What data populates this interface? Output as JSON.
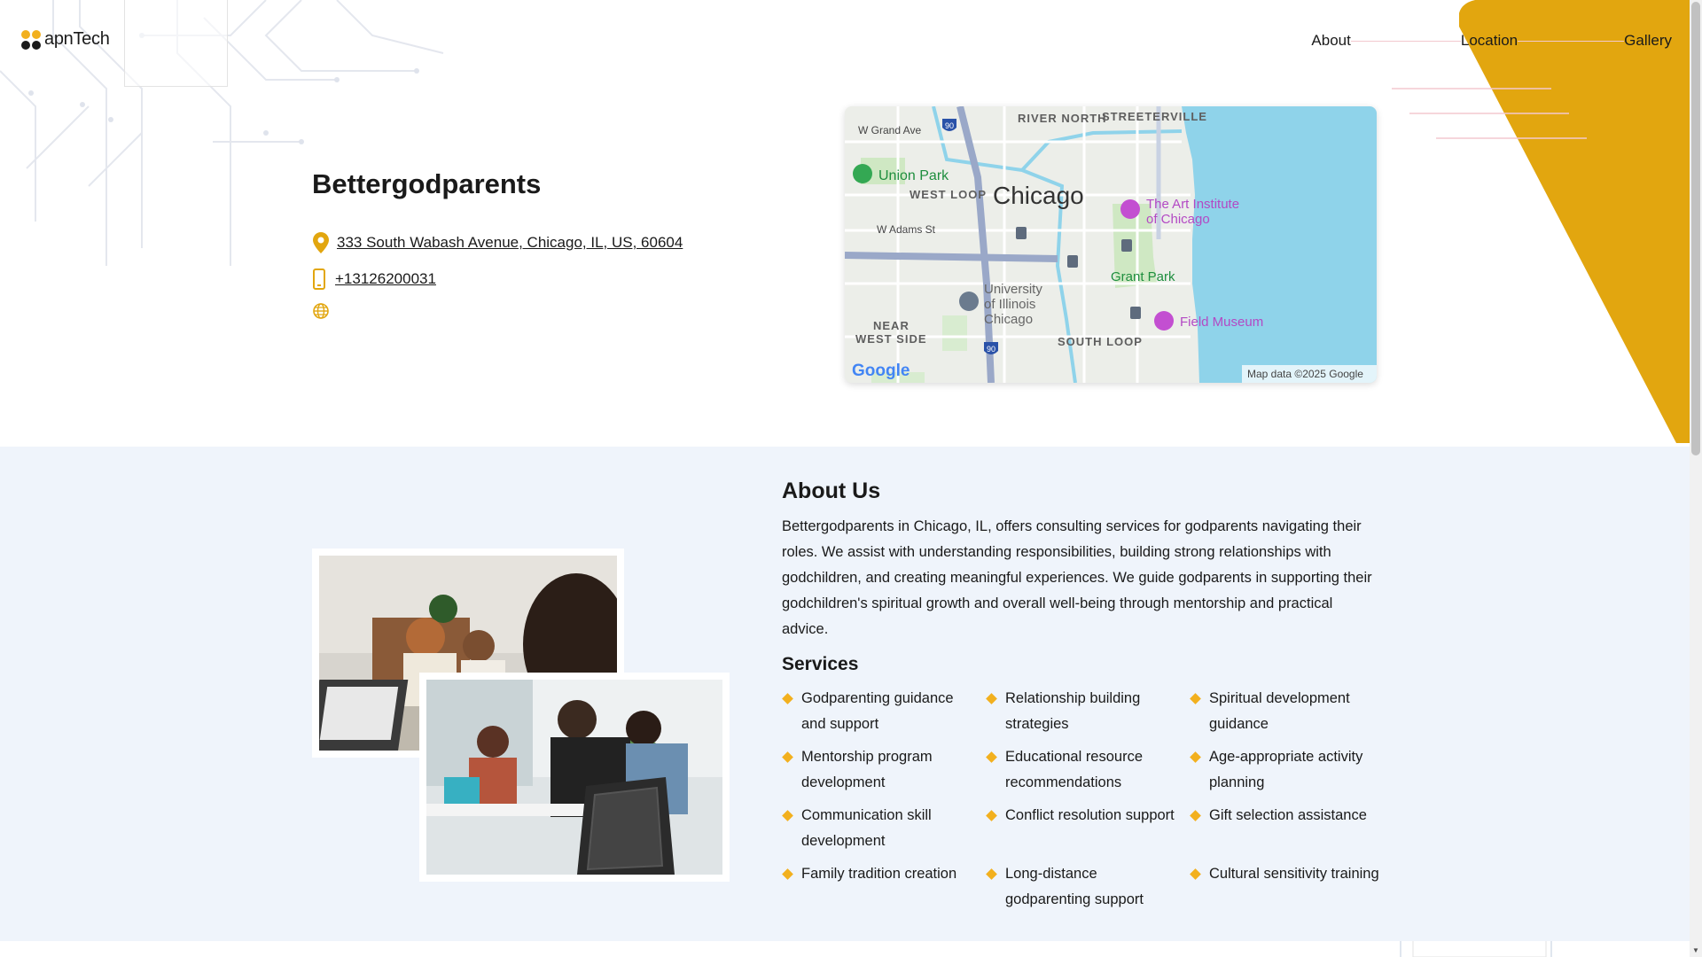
{
  "header": {
    "logo_text": "apnTech",
    "nav": [
      {
        "label": "About"
      },
      {
        "label": "Location"
      },
      {
        "label": "Gallery"
      }
    ]
  },
  "business": {
    "name": "Bettergodparents",
    "address": "333 South Wabash Avenue, Chicago, IL, US, 60604",
    "phone": "+13126200031"
  },
  "map": {
    "labels": {
      "river_north": "RIVER NORTH",
      "streeterville": "STREETERVILLE",
      "w_grand_ave": "W Grand Ave",
      "union_park": "Union Park",
      "west_loop": "WEST LOOP",
      "city": "Chicago",
      "art_institute_1": "The Art Institute",
      "art_institute_2": "of Chicago",
      "w_adams_st": "W Adams St",
      "grant_park": "Grant Park",
      "uic_1": "University",
      "uic_2": "of Illinois",
      "uic_3": "Chicago",
      "field_museum": "Field Museum",
      "near_1": "NEAR",
      "near_2": "WEST SIDE",
      "south_loop": "SOUTH LOOP",
      "interstate": "90",
      "google": "Google",
      "attribution": "Map data ©2025 Google"
    }
  },
  "about": {
    "title": "About Us",
    "text": "Bettergodparents in Chicago, IL, offers consulting services for godparents navigating their roles. We assist with understanding responsibilities, building strong relationships with godchildren, and creating meaningful experiences. We guide godparents in supporting their godchildren's spiritual growth and overall well-being through mentorship and practical advice.",
    "services_title": "Services",
    "services": [
      "Godparenting guidance and support",
      "Relationship building strategies",
      "Spiritual development guidance",
      "Mentorship program development",
      "Educational resource recommendations",
      "Age-appropriate activity planning",
      "Communication skill development",
      "Conflict resolution support",
      "Gift selection assistance",
      "Family tradition creation",
      "Long-distance godparenting support",
      "Cultural sensitivity training"
    ]
  },
  "colors": {
    "accent_yellow": "#e2a60f",
    "bullet": "#f2b01e",
    "section_bg": "#eff4fb",
    "map_water": "#8fd3ea"
  },
  "icons": {
    "address": "map-pin-icon",
    "phone": "mobile-phone-icon",
    "website": "globe-icon"
  }
}
